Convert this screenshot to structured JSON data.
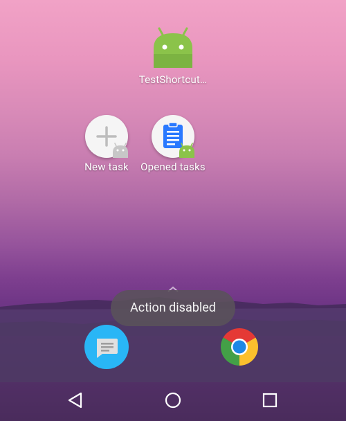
{
  "home": {
    "app_label": "TestShortcut…",
    "shortcuts": [
      {
        "label": "New task",
        "icon": "plus-icon"
      },
      {
        "label": "Opened tasks",
        "icon": "clipboard-icon"
      }
    ],
    "toast": "Action disabled",
    "dock": [
      {
        "app": "messages",
        "icon": "messages-icon"
      },
      {
        "app": "chrome",
        "icon": "chrome-icon"
      }
    ]
  },
  "navigation": {
    "buttons": [
      "back",
      "home",
      "recents"
    ]
  },
  "colors": {
    "android_green": "#8bc34a",
    "clipboard_blue": "#2979ff",
    "toast_bg": "#5a525a",
    "messages_blue": "#29b6f6"
  }
}
